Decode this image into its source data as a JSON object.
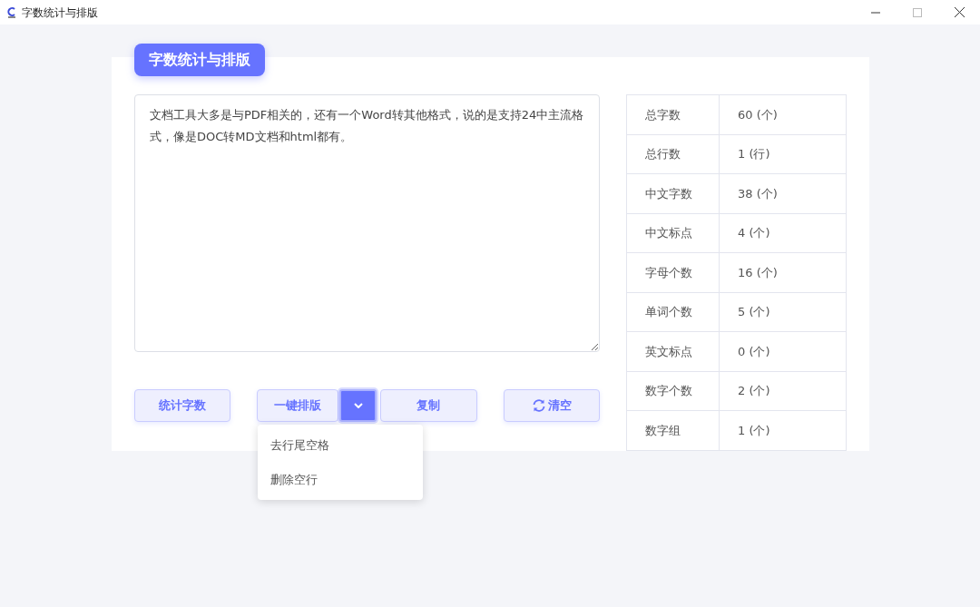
{
  "window": {
    "title": "字数统计与排版"
  },
  "panel": {
    "title": "字数统计与排版"
  },
  "editor": {
    "value": "文档工具大多是与PDF相关的，还有一个Word转其他格式，说的是支持24中主流格式，像是DOC转MD文档和html都有。"
  },
  "buttons": [
    {
      "kind": "plain",
      "label": "统计字数"
    },
    {
      "kind": "split",
      "label": "一键排版",
      "expanded": true,
      "menu": [
        "去行尾空格",
        "删除空行"
      ]
    },
    {
      "kind": "plain",
      "label": "复制"
    },
    {
      "kind": "refresh",
      "label": "清空"
    }
  ],
  "stats": [
    {
      "label": "总字数",
      "value": "60 (个)"
    },
    {
      "label": "总行数",
      "value": "1 (行)"
    },
    {
      "label": "中文字数",
      "value": "38 (个)"
    },
    {
      "label": "中文标点",
      "value": "4 (个)"
    },
    {
      "label": "字母个数",
      "value": "16 (个)"
    },
    {
      "label": "单词个数",
      "value": "5 (个)"
    },
    {
      "label": "英文标点",
      "value": "0 (个)"
    },
    {
      "label": "数字个数",
      "value": "2 (个)"
    },
    {
      "label": "数字组",
      "value": "1 (个)"
    }
  ]
}
